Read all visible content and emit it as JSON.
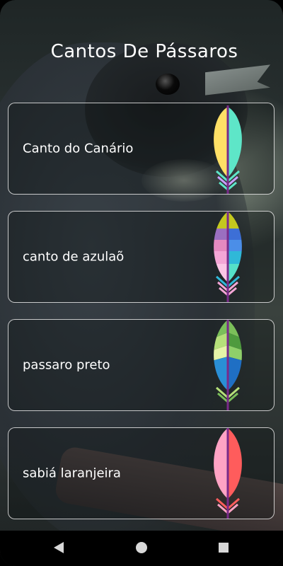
{
  "app": {
    "title": "Cantos De Pássaros"
  },
  "cards": [
    {
      "label": "Canto do Canário",
      "icon": "feather-yellow-teal-icon"
    },
    {
      "label": "canto de azulaõ",
      "icon": "feather-rainbow-icon"
    },
    {
      "label": "passaro preto",
      "icon": "feather-green-blue-icon"
    },
    {
      "label": "sabiá laranjeira",
      "icon": "feather-pink-red-icon"
    }
  ],
  "navbar": {
    "back_icon": "back-triangle-icon",
    "home_icon": "home-circle-icon",
    "recents_icon": "recents-square-icon"
  }
}
